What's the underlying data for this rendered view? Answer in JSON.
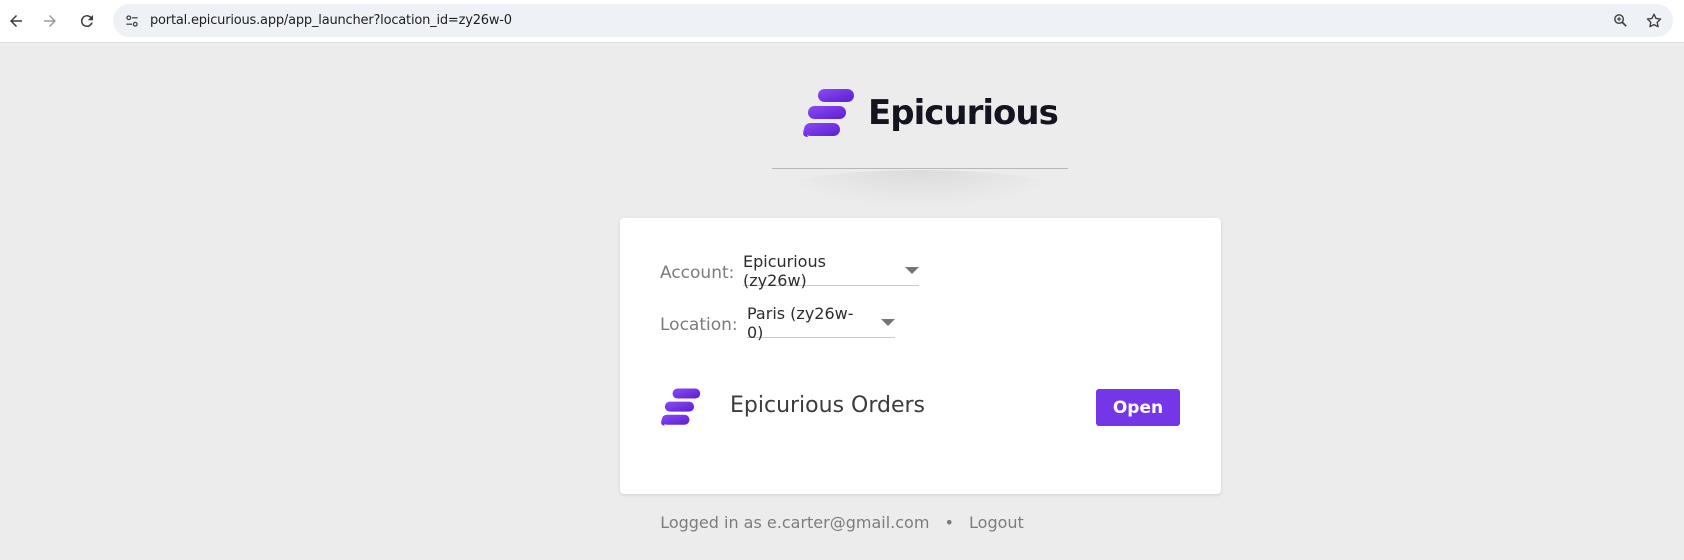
{
  "browser": {
    "url": "portal.epicurious.app/app_launcher?location_id=zy26w-0",
    "icons": [
      "back-arrow-icon",
      "forward-arrow-icon",
      "reload-icon",
      "site-info-icon",
      "zoom-icon",
      "bookmark-star-icon"
    ]
  },
  "brand": {
    "name": "Epicurious",
    "accent_color": "#7436e6"
  },
  "card": {
    "account_label": "Account:",
    "account_value": "Epicurious (zy26w)",
    "location_label": "Location:",
    "location_value": "Paris (zy26w-0)",
    "app": {
      "name": "Epicurious Orders",
      "open_label": "Open"
    }
  },
  "footer": {
    "logged_in_text": "Logged in as e.carter@gmail.com",
    "separator": "•",
    "logout_label": "Logout"
  }
}
